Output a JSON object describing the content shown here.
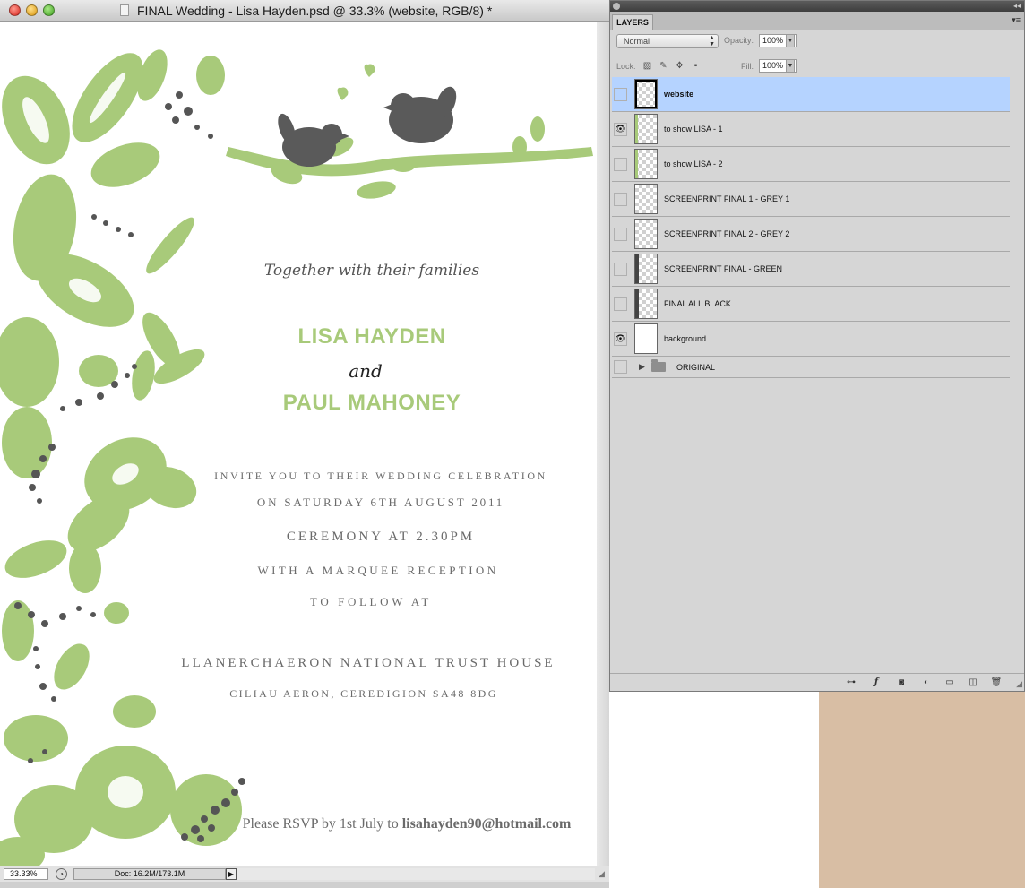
{
  "window": {
    "title": "FINAL Wedding - Lisa Hayden.psd @ 33.3% (website, RGB/8) *"
  },
  "invitation": {
    "intro": "Together with their families",
    "bride": "LISA HAYDEN",
    "and": "and",
    "groom": "PAUL MAHONEY",
    "line1": "invite you to their wedding celebration",
    "line2": "on saturday 6th august 2011",
    "line3": "Ceremony at 2.30pm",
    "line4": "with a marquee reception",
    "line5": "to follow at",
    "venue": "LLANERCHAERON NATIONAL TRUST HOUSE",
    "address": "CILIAU AERON, CEREDIGION SA48 8DG",
    "rsvp_prefix": "Please RSVP by 1st July to ",
    "rsvp_email": "lisahayden90@hotmail.com"
  },
  "statusbar": {
    "zoom": "33.33%",
    "doc_size": "Doc: 16.2M/173.1M"
  },
  "layers_panel": {
    "tab": "LAYERS",
    "blend_mode": "Normal",
    "opacity_label": "Opacity:",
    "opacity_value": "100%",
    "lock_label": "Lock:",
    "fill_label": "Fill:",
    "fill_value": "100%",
    "layers": [
      {
        "name": "website",
        "visible": false,
        "selected": true
      },
      {
        "name": "to show LISA - 1",
        "visible": true,
        "selected": false
      },
      {
        "name": "to show LISA - 2",
        "visible": false,
        "selected": false
      },
      {
        "name": "SCREENPRINT FINAL 1 - GREY 1",
        "visible": false,
        "selected": false
      },
      {
        "name": "SCREENPRINT FINAL 2 - GREY 2",
        "visible": false,
        "selected": false
      },
      {
        "name": "SCREENPRINT FINAL - GREEN",
        "visible": false,
        "selected": false
      },
      {
        "name": "FINAL ALL BLACK",
        "visible": false,
        "selected": false
      },
      {
        "name": "background",
        "visible": true,
        "selected": false
      }
    ],
    "group": {
      "name": "ORIGINAL",
      "visible": false
    }
  },
  "colors": {
    "leaf_green": "#a8ca7a",
    "bird_grey": "#5a5a5a",
    "selected_layer": "#b5d3ff",
    "desktop_tan": "#d8bea4"
  },
  "icons": {
    "eye": "eye-icon",
    "folder": "folder-icon",
    "link": "link-layers-icon",
    "fx": "layer-style-icon",
    "mask": "add-mask-icon",
    "adjustment": "adjustment-layer-icon",
    "new_group": "new-group-icon",
    "new_layer": "new-layer-icon",
    "trash": "delete-layer-icon"
  }
}
